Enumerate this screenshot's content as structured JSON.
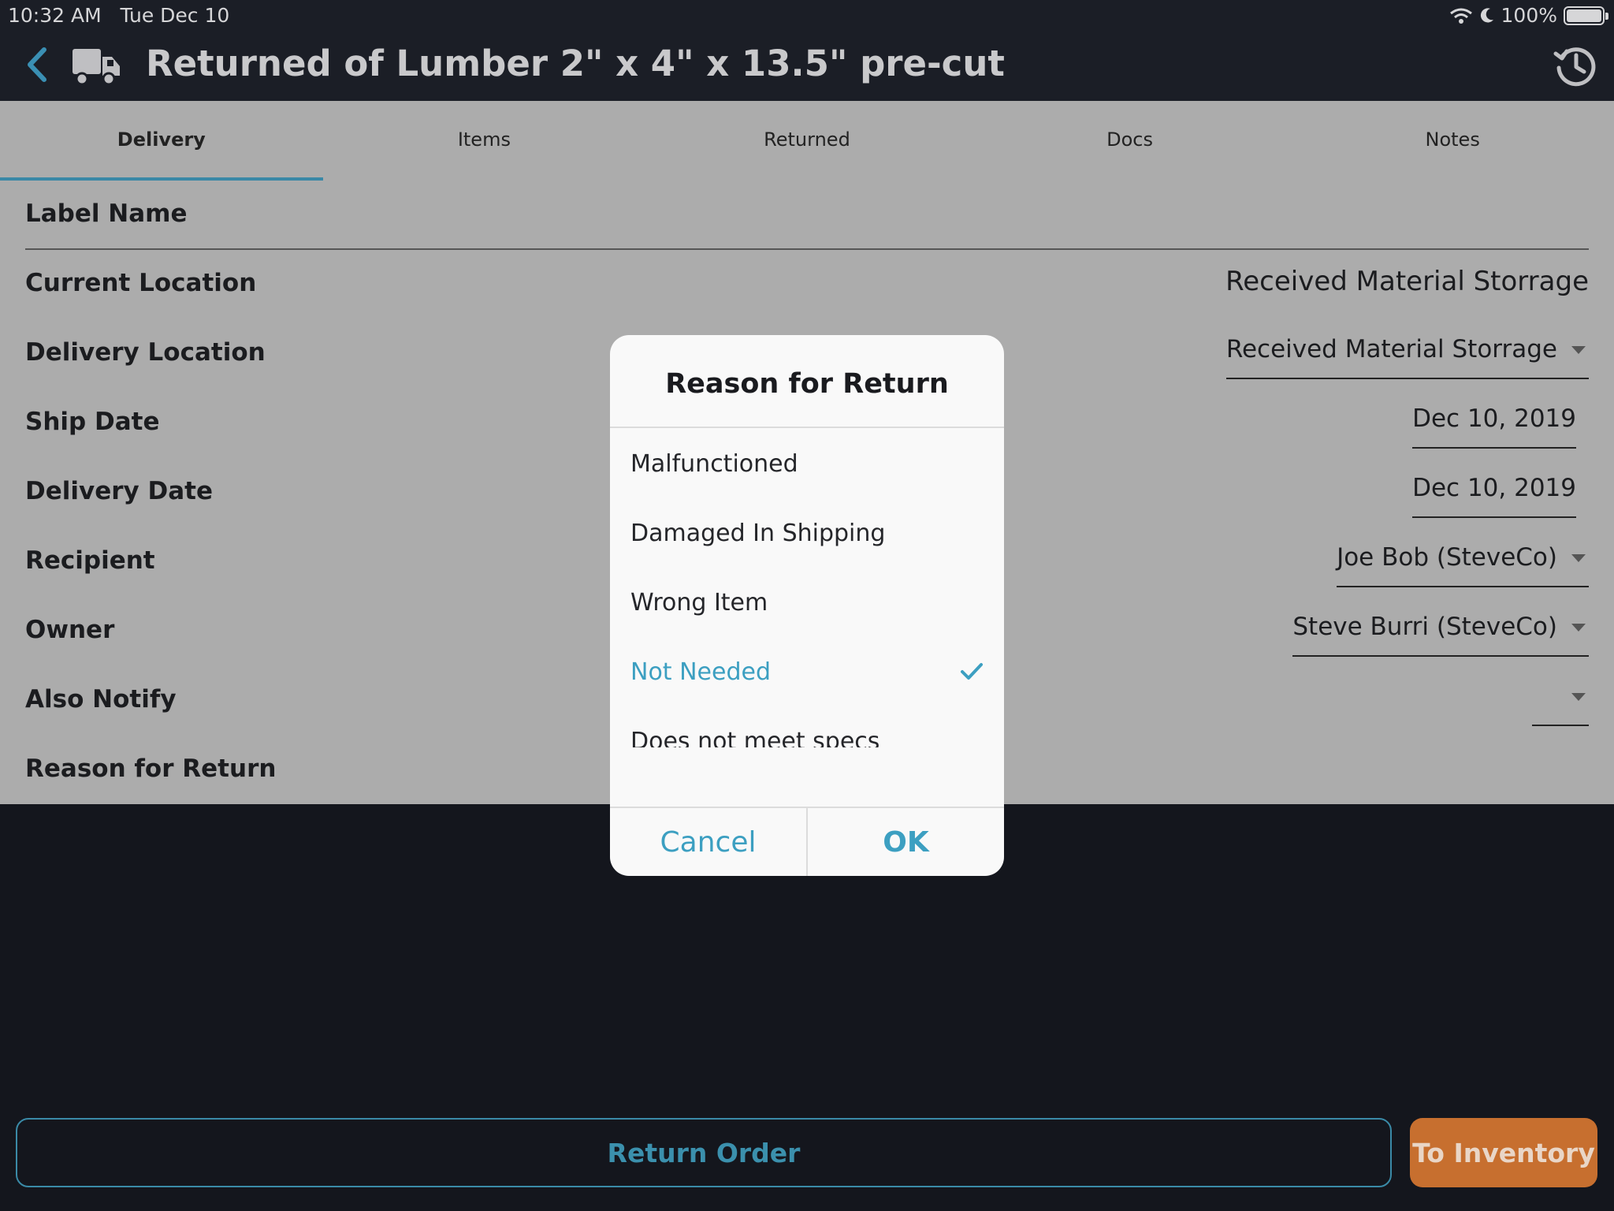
{
  "status_bar": {
    "time": "10:32 AM",
    "date": "Tue Dec 10",
    "battery": "100%",
    "icons": [
      "wifi-icon",
      "moon-icon",
      "battery-icon"
    ]
  },
  "header": {
    "title": "Returned of Lumber 2\" x 4\" x 13.5\" pre-cut",
    "icons": [
      "back-chevron-icon",
      "truck-icon",
      "history-icon"
    ]
  },
  "tabs": [
    {
      "label": "Delivery",
      "active": true
    },
    {
      "label": "Items",
      "active": false
    },
    {
      "label": "Returned",
      "active": false
    },
    {
      "label": "Docs",
      "active": false
    },
    {
      "label": "Notes",
      "active": false
    }
  ],
  "form": {
    "label_name": {
      "label": "Label Name"
    },
    "current_location": {
      "label": "Current Location",
      "value": "Received Material Storrage"
    },
    "delivery_location": {
      "label": "Delivery Location",
      "value": "Received Material Storrage"
    },
    "ship_date": {
      "label": "Ship Date",
      "value": "Dec 10, 2019"
    },
    "delivery_date": {
      "label": "Delivery Date",
      "value": "Dec 10, 2019"
    },
    "recipient": {
      "label": "Recipient",
      "value": "Joe Bob (SteveCo)"
    },
    "owner": {
      "label": "Owner",
      "value": "Steve Burri (SteveCo)"
    },
    "also_notify": {
      "label": "Also Notify",
      "value": ""
    },
    "reason_for_return": {
      "label": "Reason for Return"
    }
  },
  "modal": {
    "title": "Reason for Return",
    "options": [
      {
        "label": "Malfunctioned",
        "selected": false
      },
      {
        "label": "Damaged In Shipping",
        "selected": false
      },
      {
        "label": "Wrong Item",
        "selected": false
      },
      {
        "label": "Not Needed",
        "selected": true
      },
      {
        "label": "Does not meet specs",
        "selected": false
      }
    ],
    "cancel_label": "Cancel",
    "ok_label": "OK"
  },
  "bottom_bar": {
    "return_order_label": "Return Order",
    "to_inventory_label": "To Inventory"
  },
  "colors": {
    "accent": "#3c9fc1",
    "header_bg": "#1b1e26",
    "form_bg": "#acacac",
    "orange_button": "#c76f2f"
  }
}
